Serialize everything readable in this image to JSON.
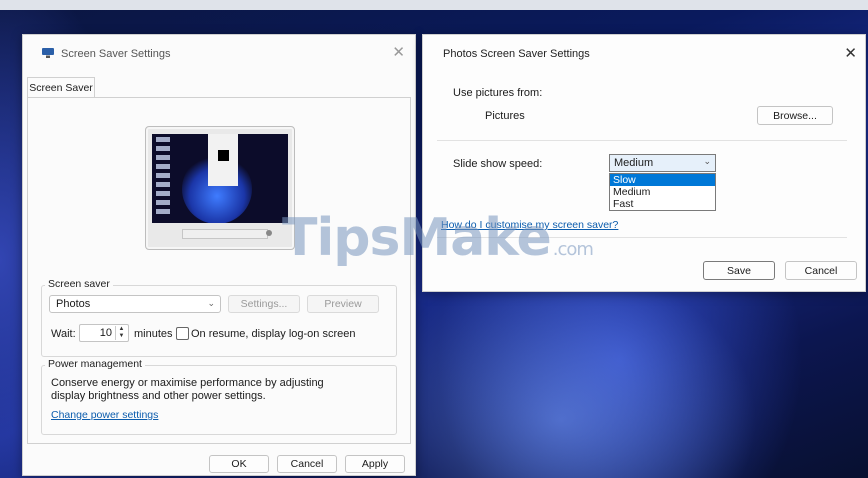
{
  "screen_saver_dialog": {
    "title": "Screen Saver Settings",
    "tab": "Screen Saver",
    "screen_saver_group": {
      "legend": "Screen saver",
      "selected": "Photos",
      "settings_label": "Settings...",
      "preview_label": "Preview",
      "wait_label": "Wait:",
      "wait_value": "10",
      "minutes_label": "minutes",
      "resume_label": "On resume, display log-on screen"
    },
    "power_group": {
      "legend": "Power management",
      "description": "Conserve energy or maximise performance by adjusting display brightness and other power settings.",
      "link": "Change power settings"
    },
    "buttons": {
      "ok": "OK",
      "cancel": "Cancel",
      "apply": "Apply"
    }
  },
  "photos_dialog": {
    "title": "Photos Screen Saver Settings",
    "use_pictures_label": "Use pictures from:",
    "folder": "Pictures",
    "browse_label": "Browse...",
    "speed_label": "Slide show speed:",
    "speed_selected": "Medium",
    "speed_options": [
      "Slow",
      "Medium",
      "Fast"
    ],
    "highlighted_option": "Slow",
    "help_link": "How do I customise my screen saver?",
    "save_label": "Save",
    "cancel_label": "Cancel"
  },
  "watermark": {
    "main": "TipsMake",
    "suffix": ".com"
  },
  "colors": {
    "accent": "#0078d7",
    "link": "#0b5cad"
  }
}
